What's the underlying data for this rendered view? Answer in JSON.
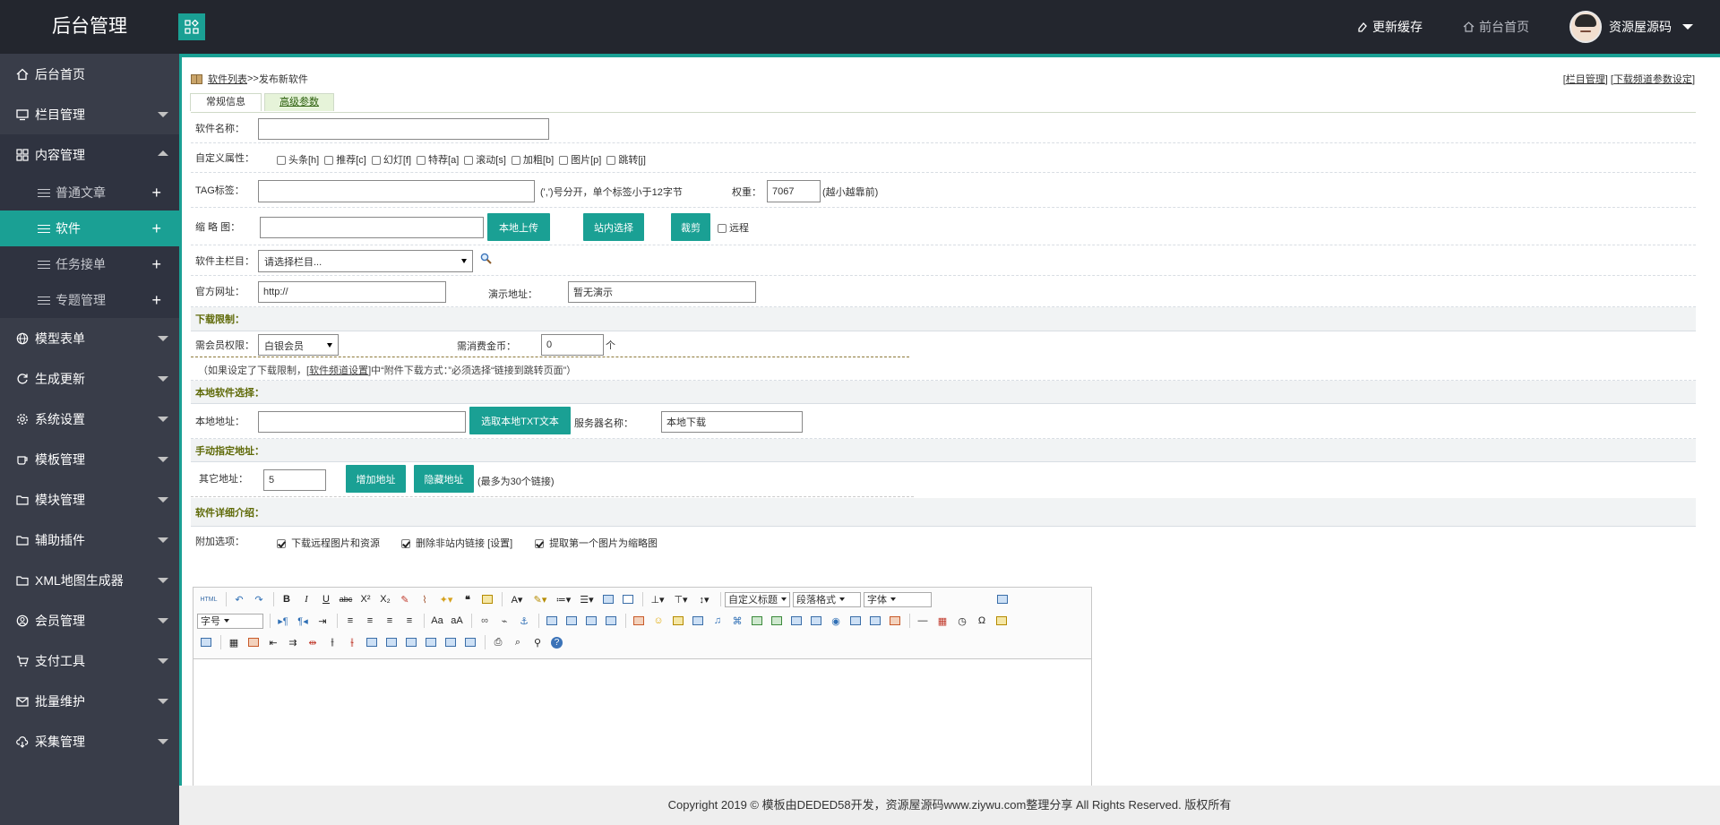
{
  "topbar": {
    "brand": "后台管理",
    "refresh_cache": "更新缓存",
    "front_home": "前台首页",
    "username": "资源屋源码"
  },
  "sidebar": {
    "items": [
      {
        "label": "后台首页",
        "icon": "home-icon"
      },
      {
        "label": "栏目管理",
        "icon": "monitor-icon"
      },
      {
        "label": "内容管理",
        "icon": "grid-icon"
      },
      {
        "label": "模型表单",
        "icon": "globe-icon"
      },
      {
        "label": "生成更新",
        "icon": "refresh-icon"
      },
      {
        "label": "系统设置",
        "icon": "gear-icon"
      },
      {
        "label": "模板管理",
        "icon": "cup-icon"
      },
      {
        "label": "模块管理",
        "icon": "folder-icon"
      },
      {
        "label": "辅助插件",
        "icon": "folder-icon"
      },
      {
        "label": "XML地图生成器",
        "icon": "folder-icon"
      },
      {
        "label": "会员管理",
        "icon": "user-icon"
      },
      {
        "label": "支付工具",
        "icon": "cart-icon"
      },
      {
        "label": "批量维护",
        "icon": "mail-icon"
      },
      {
        "label": "采集管理",
        "icon": "cloud-icon"
      }
    ],
    "subitems": [
      {
        "label": "普通文章"
      },
      {
        "label": "软件"
      },
      {
        "label": "任务接单"
      },
      {
        "label": "专题管理"
      }
    ]
  },
  "breadcrumb": {
    "link": "软件列表",
    "sep": ">>",
    "current": "发布新软件"
  },
  "toplinks": {
    "a": "栏目管理",
    "b": "下载频道参数设定"
  },
  "tabs": {
    "t1": "常规信息",
    "t2": "高级参数"
  },
  "form": {
    "name_label": "软件名称：",
    "custom_label": "自定义属性：",
    "flags": [
      "头条[h]",
      "推荐[c]",
      "幻灯[f]",
      "特荐[a]",
      "滚动[s]",
      "加粗[b]",
      "图片[p]",
      "跳转[j]"
    ],
    "tag_label": "TAG标签：",
    "tag_hint": "(',')号分开，单个标签小于12字节",
    "weight_label": "权重：",
    "weight_value": "7067",
    "weight_hint": "(越小越靠前)",
    "thumb_label": "缩 略 图：",
    "btn_upload": "本地上传",
    "btn_site": "站内选择",
    "btn_crop": "裁剪",
    "remote": "远程",
    "column_label": "软件主栏目：",
    "column_value": "请选择栏目...",
    "site_label": "官方网址：",
    "site_value": "http://",
    "demo_label": "演示地址：",
    "demo_value": "暂无演示",
    "dl_limit": "下载限制：",
    "member_label": "需会员权限：",
    "member_value": "白银会员",
    "coin_label": "需消费金币：",
    "coin_value": "0",
    "coin_unit": "个",
    "note_pre": "（如果设定了下载限制，[",
    "note_link": "软件频道设置",
    "note_post": "]中“附件下载方式：”必须选择“链接到跳转页面”）",
    "local_head": "本地软件选择：",
    "local_label": "本地地址：",
    "btn_txt": "选取本地TXT文本",
    "server_label": "服务器名称：",
    "server_value": "本地下载",
    "manual_head": "手动指定地址：",
    "other_label": "其它地址：",
    "other_value": "5",
    "btn_add": "增加地址",
    "btn_hide": "隐藏地址",
    "max_hint": "(最多为30个链接)",
    "detail_head": "软件详细介绍：",
    "extra_label": "附加选项：",
    "extra1": "下载远程图片和资源",
    "extra2": "删除非站内链接",
    "extra2b": "[设置]",
    "extra3": "提取第一个图片为缩略图"
  },
  "editor": {
    "html": "HTML",
    "custom_title": "自定义标题",
    "para": "段落格式",
    "font": "字体",
    "size": "字号"
  },
  "footer": {
    "text": "Copyright 2019 © 模板由DEDED58开发，资源屋源码www.ziywu.com整理分享 All Rights Reserved. 版权所有"
  }
}
